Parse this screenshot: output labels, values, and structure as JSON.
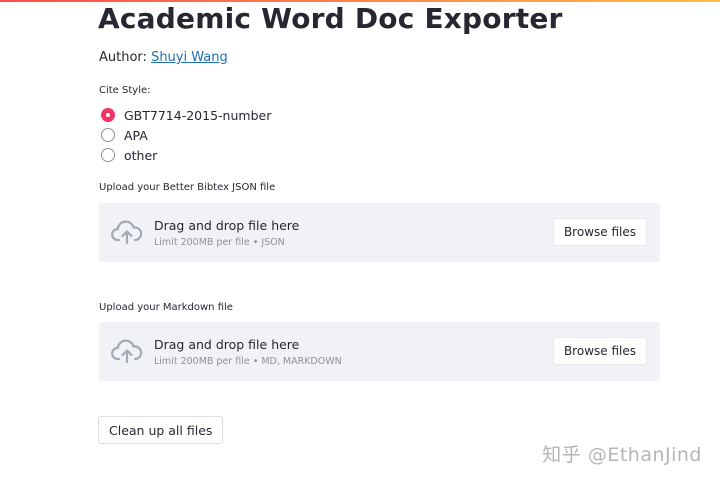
{
  "app": {
    "title": "Academic Word Doc Exporter",
    "author_prefix": "Author: ",
    "author_name": "Shuyi Wang"
  },
  "cite_style": {
    "label": "Cite Style:",
    "options": [
      "GBT7714-2015-number",
      "APA",
      "other"
    ],
    "selected": "GBT7714-2015-number"
  },
  "json_upload": {
    "label": "Upload your Better Bibtex JSON file",
    "drag_text": "Drag and drop file here",
    "limit_text": "Limit 200MB per file • JSON",
    "browse_label": "Browse files"
  },
  "md_upload": {
    "label": "Upload your Markdown file",
    "drag_text": "Drag and drop file here",
    "limit_text": "Limit 200MB per file • MD, MARKDOWN",
    "browse_label": "Browse files"
  },
  "actions": {
    "cleanup_label": "Clean up all files"
  },
  "watermark": {
    "text": "知乎 @EthanJind"
  },
  "colors": {
    "accent": "#f63366",
    "link": "#1f6fb2",
    "dropzone_bg": "#f0f2f6",
    "text": "#262730",
    "muted": "#8f9099"
  },
  "icons": {
    "upload": "cloud-upload-icon"
  }
}
